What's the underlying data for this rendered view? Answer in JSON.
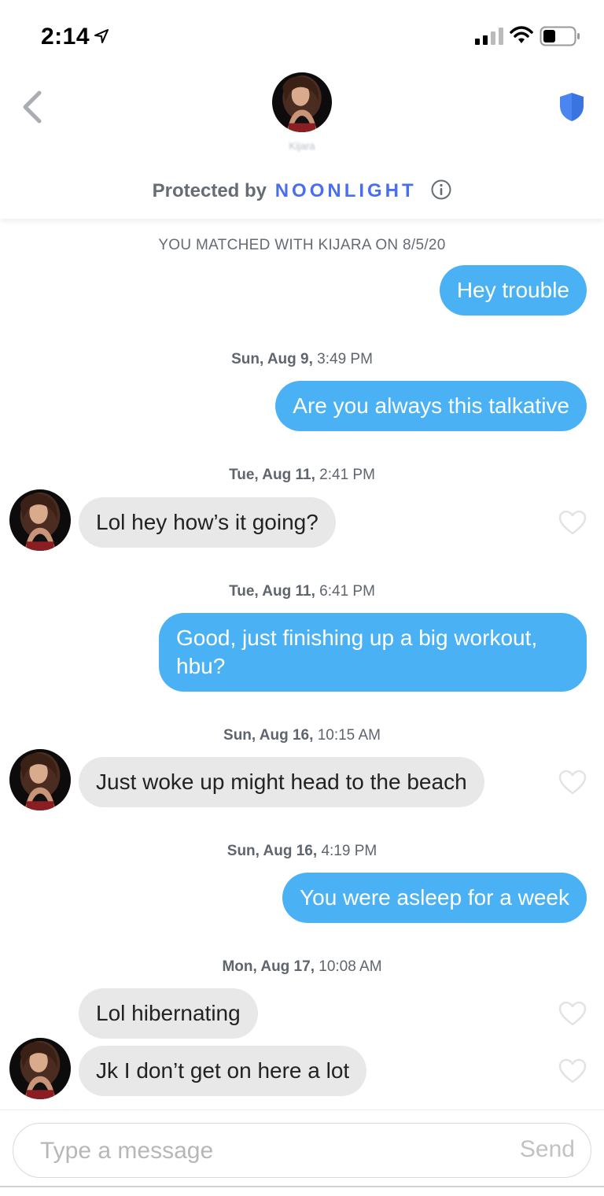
{
  "status_bar": {
    "time": "2:14",
    "icons": [
      "location-arrow-icon",
      "signal-icon",
      "wifi-icon",
      "battery-icon"
    ]
  },
  "header": {
    "back_icon": "chevron-left-icon",
    "contact_name": "Kijara",
    "shield_icon": "shield-icon",
    "protected_prefix": "Protected by",
    "protected_brand": "NOONLIGHT",
    "info_icon": "info-icon"
  },
  "conversation": {
    "match_notice": "YOU MATCHED WITH KIJARA ON 8/5/20",
    "items": [
      {
        "type": "message",
        "direction": "outgoing",
        "text": "Hey trouble"
      },
      {
        "type": "date",
        "day": "Sun, Aug 9,",
        "time": "3:49 PM"
      },
      {
        "type": "message",
        "direction": "outgoing",
        "text": "Are you always this talkative"
      },
      {
        "type": "date",
        "day": "Tue, Aug 11,",
        "time": "2:41 PM"
      },
      {
        "type": "message",
        "direction": "incoming",
        "text": "Lol hey how’s it going?",
        "liked": false
      },
      {
        "type": "date",
        "day": "Tue, Aug 11,",
        "time": "6:41 PM"
      },
      {
        "type": "message",
        "direction": "outgoing",
        "text": "Good, just finishing up a big workout, hbu?"
      },
      {
        "type": "date",
        "day": "Sun, Aug 16,",
        "time": "10:15 AM"
      },
      {
        "type": "message",
        "direction": "incoming",
        "text": "Just woke up might head to the beach",
        "liked": false
      },
      {
        "type": "date",
        "day": "Sun, Aug 16,",
        "time": "4:19 PM"
      },
      {
        "type": "message",
        "direction": "outgoing",
        "text": "You were asleep for a week"
      },
      {
        "type": "date",
        "day": "Mon, Aug 17,",
        "time": "10:08 AM"
      },
      {
        "type": "message",
        "direction": "incoming",
        "text": "Lol hibernating",
        "liked": false
      },
      {
        "type": "message",
        "direction": "incoming",
        "text": "Jk I don’t get on here a lot",
        "liked": false
      }
    ]
  },
  "input": {
    "placeholder": "Type a message",
    "value": "",
    "send_label": "Send"
  },
  "colors": {
    "outgoing_bubble": "#4ab2f4",
    "incoming_bubble": "#e8e8e8",
    "brand_blue": "#4a6ef2",
    "shield_blue": "#4a86f0"
  }
}
